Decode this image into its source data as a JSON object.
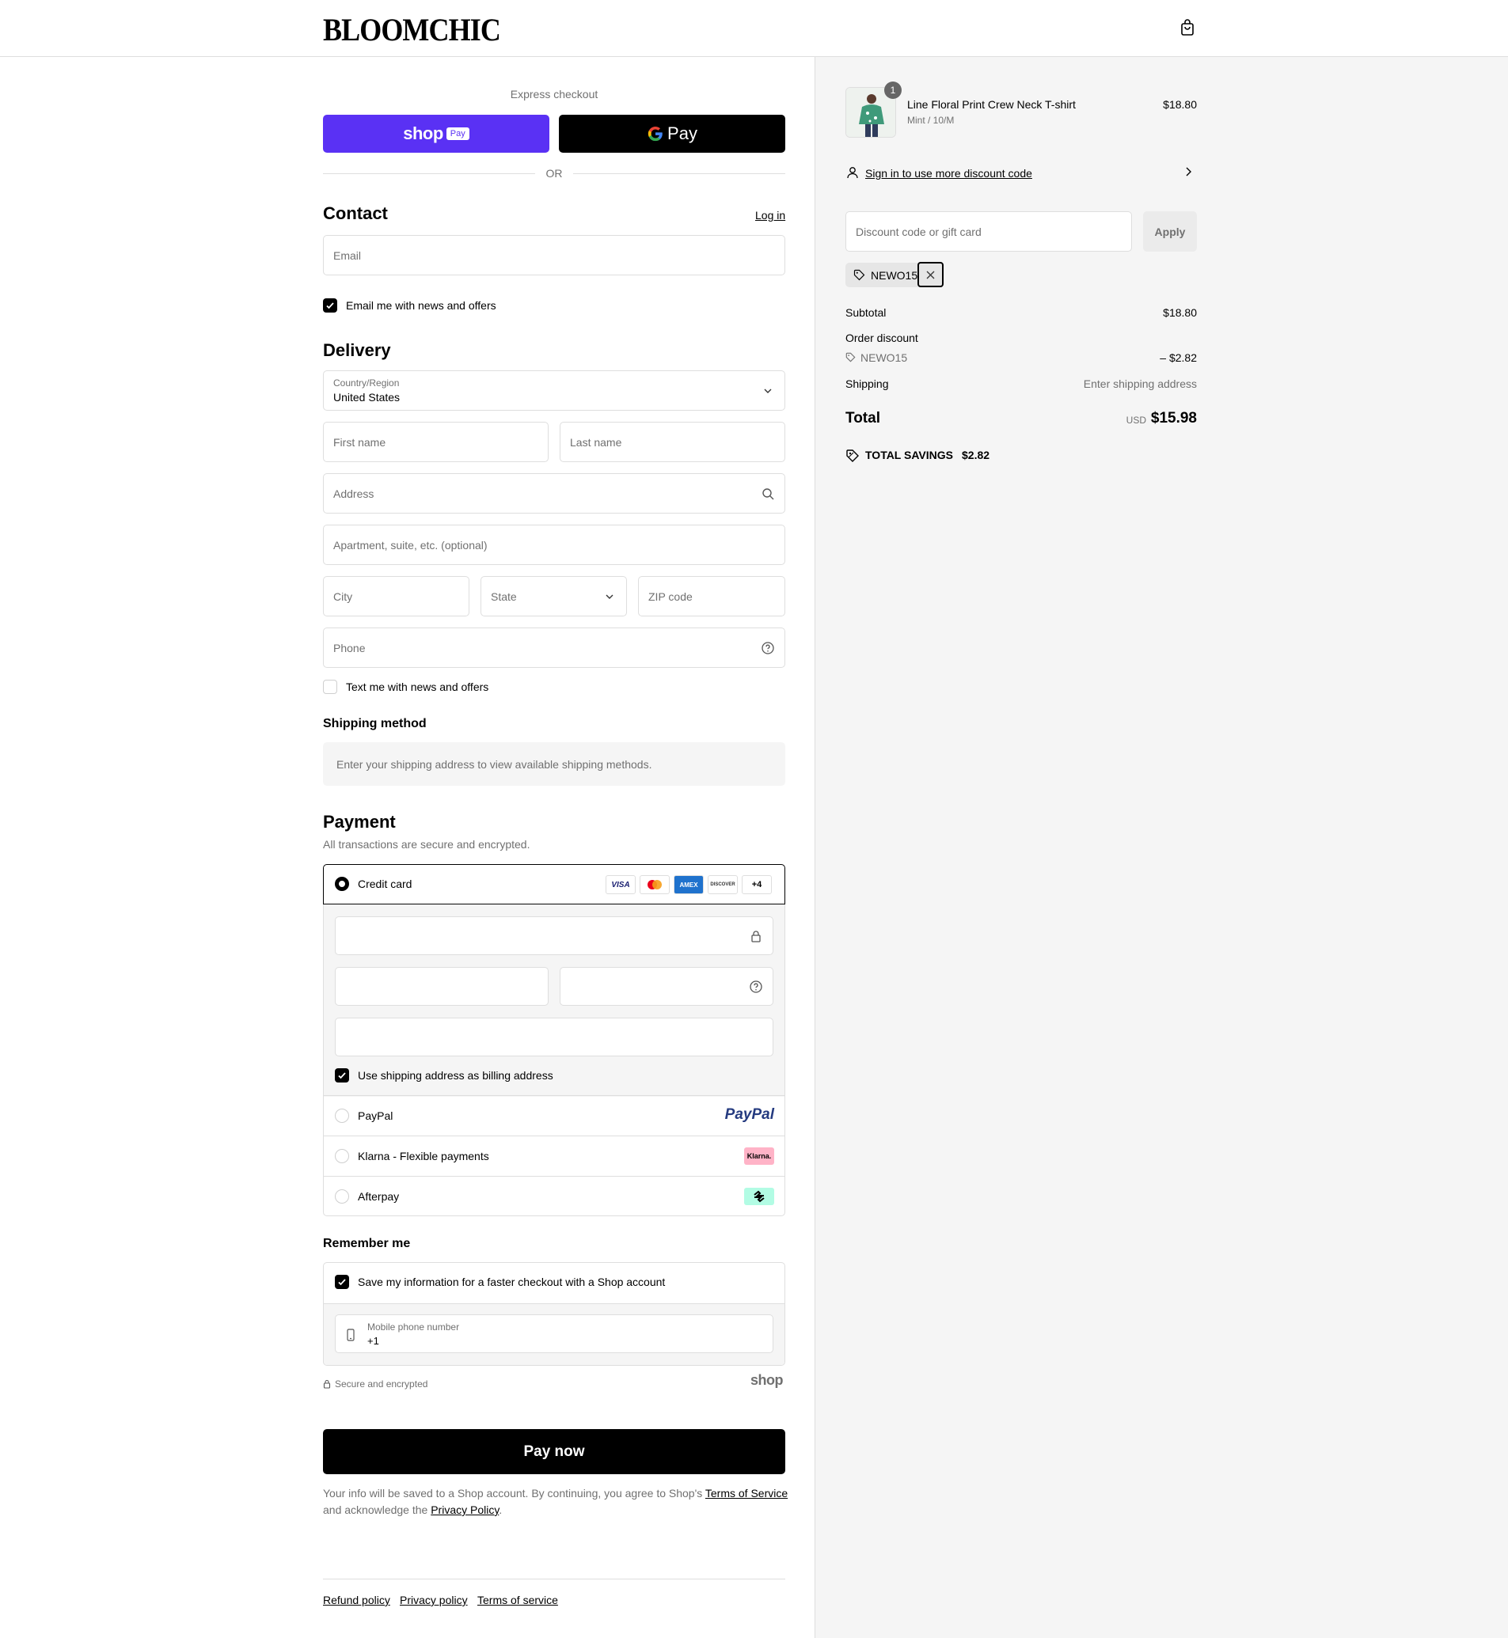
{
  "header": {
    "logo": "BLOOMCHIC"
  },
  "express": {
    "title": "Express checkout",
    "shoppay_label": "shop",
    "shoppay_badge": "Pay",
    "gpay_label": "Pay",
    "or": "OR"
  },
  "contact": {
    "title": "Contact",
    "login": "Log in",
    "email_placeholder": "Email",
    "news_label": "Email me with news and offers"
  },
  "delivery": {
    "title": "Delivery",
    "country_label": "Country/Region",
    "country_value": "United States",
    "first_name": "First name",
    "last_name": "Last name",
    "address": "Address",
    "apartment": "Apartment, suite, etc. (optional)",
    "city": "City",
    "state": "State",
    "zip": "ZIP code",
    "phone": "Phone",
    "text_news": "Text me with news and offers"
  },
  "shipping_method": {
    "title": "Shipping method",
    "notice": "Enter your shipping address to view available shipping methods."
  },
  "payment": {
    "title": "Payment",
    "subtitle": "All transactions are secure and encrypted.",
    "credit_card": "Credit card",
    "cards": [
      "VISA",
      "",
      "AMEX",
      "DISCOVER",
      "+4"
    ],
    "billing_same": "Use shipping address as billing address",
    "paypal": "PayPal",
    "paypal_logo": "PayPal",
    "klarna": "Klarna - Flexible payments",
    "klarna_logo": "Klarna.",
    "afterpay": "Afterpay"
  },
  "remember": {
    "title": "Remember me",
    "save_label": "Save my information for a faster checkout with a Shop account",
    "mobile_label": "Mobile phone number",
    "mobile_value": "+1",
    "secure": "Secure and encrypted",
    "shop_logo": "shop"
  },
  "pay_now": "Pay now",
  "legal": {
    "line1": "Your info will be saved to a Shop account. By continuing, you agree to Shop's",
    "terms": "Terms of Service",
    "line2": "and acknowledge the",
    "privacy": "Privacy Policy",
    "period": "."
  },
  "footer": [
    "Refund policy",
    "Privacy policy",
    "Terms of service"
  ],
  "summary": {
    "product": {
      "qty": "1",
      "name": "Line Floral Print Crew Neck T-shirt",
      "variant": "Mint / 10/M",
      "price": "$18.80"
    },
    "signin_discount": "Sign in to use more discount code",
    "discount_placeholder": "Discount code or gift card",
    "apply": "Apply",
    "code_tag": "NEWO15",
    "subtotal_label": "Subtotal",
    "subtotal_value": "$18.80",
    "order_discount_label": "Order discount",
    "order_discount_code": "NEWO15",
    "order_discount_value": "– $2.82",
    "shipping_label": "Shipping",
    "shipping_value": "Enter shipping address",
    "total_label": "Total",
    "currency": "USD",
    "total_value": "$15.98",
    "savings_label": "TOTAL SAVINGS",
    "savings_value": "$2.82"
  },
  "colors": {
    "shoppay": "#5a31f4",
    "accent": "#000000",
    "summary_bg": "#f5f5f5",
    "klarna": "#ffb3c7",
    "afterpay": "#b2fce4"
  }
}
